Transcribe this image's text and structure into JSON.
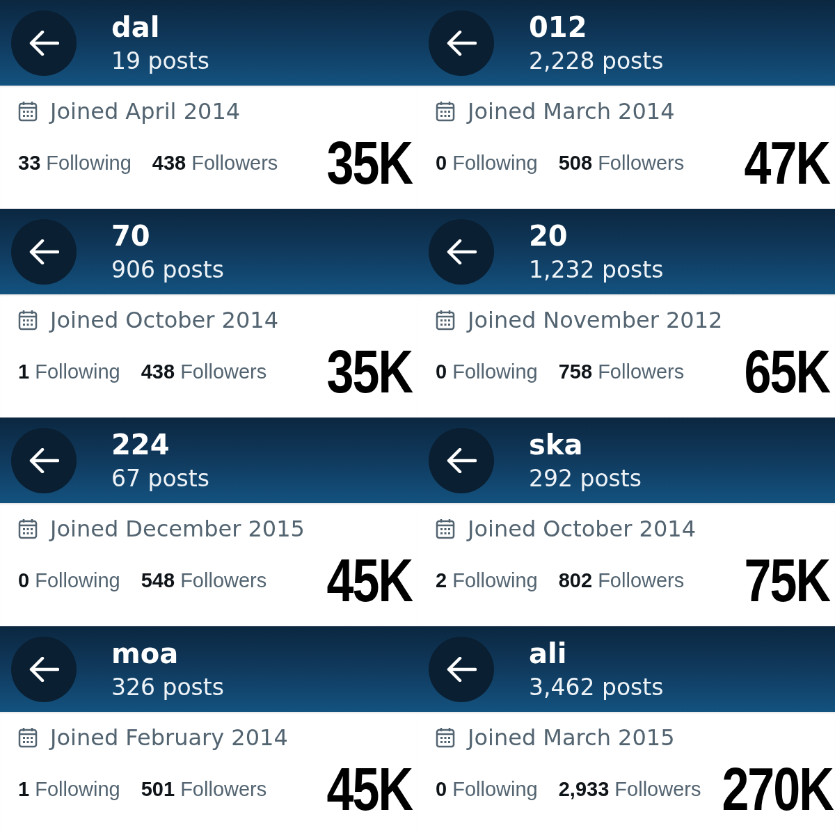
{
  "profiles": [
    {
      "name": "dal",
      "posts": "19 posts",
      "joined": "Joined April 2014",
      "following_count": "33",
      "following_label": "Following",
      "followers_count": "438",
      "followers_label": "Followers",
      "price": "35K"
    },
    {
      "name": "012",
      "posts": "2,228 posts",
      "joined": "Joined March 2014",
      "following_count": "0",
      "following_label": "Following",
      "followers_count": "508",
      "followers_label": "Followers",
      "price": "47K"
    },
    {
      "name": "70",
      "posts": "906 posts",
      "joined": "Joined October 2014",
      "following_count": "1",
      "following_label": "Following",
      "followers_count": "438",
      "followers_label": "Followers",
      "price": "35K"
    },
    {
      "name": "20",
      "posts": "1,232 posts",
      "joined": "Joined November 2012",
      "following_count": "0",
      "following_label": "Following",
      "followers_count": "758",
      "followers_label": "Followers",
      "price": "65K"
    },
    {
      "name": "224",
      "posts": "67 posts",
      "joined": "Joined December 2015",
      "following_count": "0",
      "following_label": "Following",
      "followers_count": "548",
      "followers_label": "Followers",
      "price": "45K"
    },
    {
      "name": "ska",
      "posts": "292 posts",
      "joined": "Joined October 2014",
      "following_count": "2",
      "following_label": "Following",
      "followers_count": "802",
      "followers_label": "Followers",
      "price": "75K"
    },
    {
      "name": "moa",
      "posts": "326 posts",
      "joined": "Joined February 2014",
      "following_count": "1",
      "following_label": "Following",
      "followers_count": "501",
      "followers_label": "Followers",
      "price": "45K"
    },
    {
      "name": "ali",
      "posts": "3,462 posts",
      "joined": "Joined March 2015",
      "following_count": "0",
      "following_label": "Following",
      "followers_count": "2,933",
      "followers_label": "Followers",
      "price": "270K"
    }
  ]
}
